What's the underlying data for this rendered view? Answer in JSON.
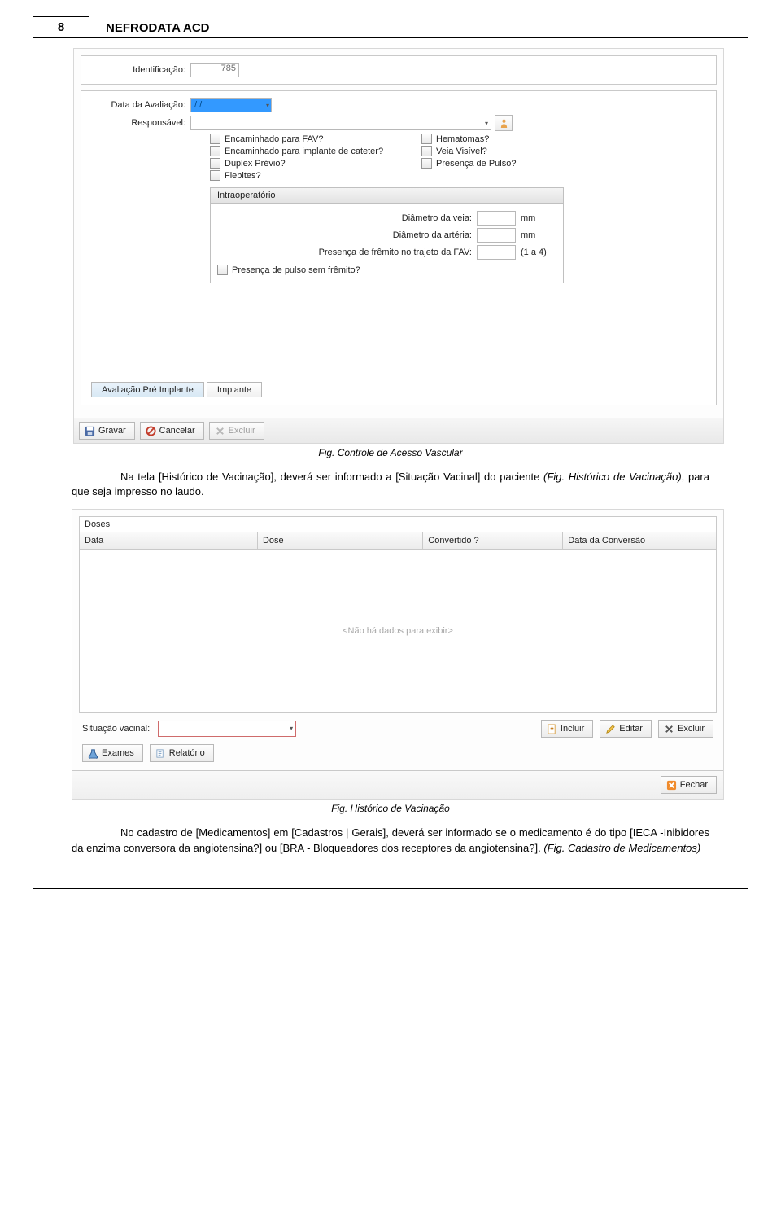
{
  "page": {
    "number": "8",
    "title": "NEFRODATA ACD"
  },
  "fig1": {
    "identificacao_label": "Identificação:",
    "identificacao_value": "785",
    "data_avaliacao_label": "Data da Avaliação:",
    "data_avaliacao_value": "  /  /",
    "responsavel_label": "Responsável:",
    "check1_a": "Encaminhado para FAV?",
    "check1_b": "Hematomas?",
    "check2_a": "Encaminhado para implante de cateter?",
    "check2_b": "Veia Visível?",
    "check3_a": "Duplex Prévio?",
    "check3_b": "Presença de Pulso?",
    "check4_a": "Flebites?",
    "subpanel_title": "Intraoperatório",
    "diam_veia_label": "Diâmetro da veia:",
    "diam_veia_unit": "mm",
    "diam_arteria_label": "Diâmetro da artéria:",
    "diam_arteria_unit": "mm",
    "fremito_label": "Presença de frêmito no trajeto da FAV:",
    "fremito_unit": "(1 a 4)",
    "pulso_sem_fremito": "Presença de pulso sem frêmito?",
    "tab_active": "Avaliação Pré Implante",
    "tab_other": "Implante",
    "btn_gravar": "Gravar",
    "btn_cancelar": "Cancelar",
    "btn_excluir": "Excluir",
    "caption": "Fig. Controle de Acesso Vascular"
  },
  "para1": {
    "line1a": "Na tela [Histórico de Vacinação], deverá ser informado a [Situação Vacinal] do paciente ",
    "line1b": "(Fig. Histórico de Vacinação)",
    "line1c": ", para que seja impresso no laudo."
  },
  "fig2": {
    "doses_hdr": "Doses",
    "col_data": "Data",
    "col_dose": "Dose",
    "col_conv": "Convertido ?",
    "col_dataconv": "Data da Conversão",
    "empty": "<Não há dados para exibir>",
    "situacao_label": "Situação vacinal:",
    "btn_incluir": "Incluir",
    "btn_editar": "Editar",
    "btn_excluir": "Excluir",
    "btn_exames": "Exames",
    "btn_relatorio": "Relatório",
    "btn_fechar": "Fechar",
    "caption": "Fig. Histórico de Vacinação"
  },
  "para2": {
    "t1": "No cadastro de [Medicamentos] em [Cadastros | Gerais], deverá ser informado se o medicamento é do tipo [IECA -Inibidores da enzima conversora da angiotensina?] ou [BRA - Bloqueadores dos receptores da angiotensina?]. ",
    "t2": "(Fig. Cadastro de Medicamentos)"
  }
}
